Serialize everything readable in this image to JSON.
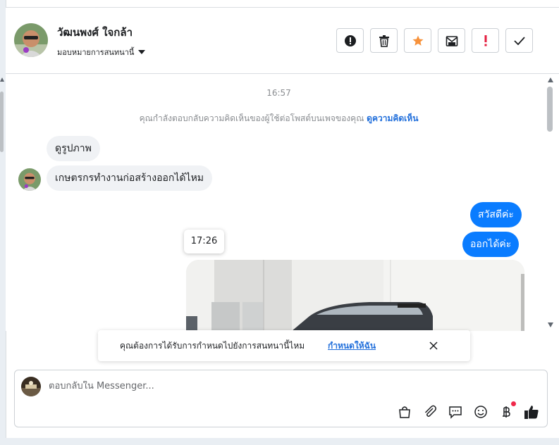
{
  "header": {
    "contact_name": "วัฒนพงศ์ ใจกล้า",
    "assign_label": "มอบหมายการสนทนานี้",
    "actions": [
      {
        "name": "report-spam",
        "icon": "alert-circle-icon"
      },
      {
        "name": "delete",
        "icon": "trash-icon"
      },
      {
        "name": "star",
        "icon": "star-icon"
      },
      {
        "name": "mark-unread",
        "icon": "envelope-icon"
      },
      {
        "name": "important",
        "icon": "exclamation-icon"
      },
      {
        "name": "done",
        "icon": "check-icon"
      }
    ]
  },
  "conversation": {
    "timestamp_1": "16:57",
    "notice_text": "คุณกำลังตอบกลับความคิดเห็นของผู้ใช้ต่อโพสต์บนเพจของคุณ",
    "notice_link": "ดูความคิดเห็น",
    "incoming": [
      "ดูรูปภาพ",
      "เกษตรกรทำงานก่อสร้างออกได้ไหม"
    ],
    "outgoing": [
      "สวัสดีค่ะ",
      "ออกได้ค่ะ"
    ],
    "tooltip_time": "17:26"
  },
  "banner": {
    "text": "คุณต้องการได้รับการกำหนดไปยังการสนทนานี้ไหม",
    "link": "กำหนดให้ฉัน"
  },
  "composer": {
    "placeholder": "ตอบกลับใน Messenger...",
    "tools": [
      "bag-icon",
      "paperclip-icon",
      "chat-icon",
      "emoji-icon",
      "baht-icon",
      "thumbs-up-icon"
    ]
  },
  "colors": {
    "accent": "#0a7cff",
    "star": "#f7923b",
    "alert_red": "#e41e3f"
  }
}
